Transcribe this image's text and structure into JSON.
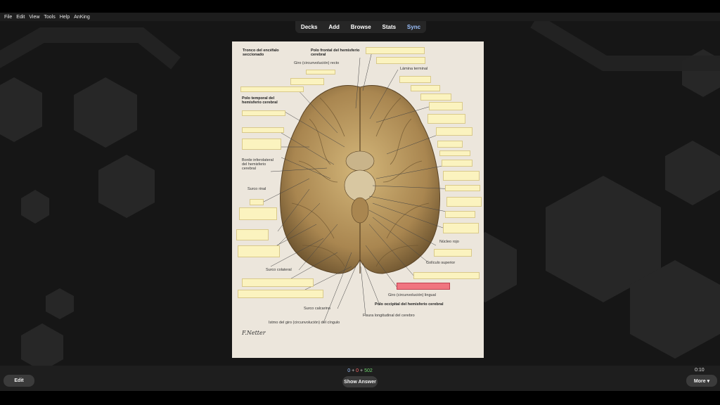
{
  "menu": [
    "File",
    "Edit",
    "View",
    "Tools",
    "Help",
    "AnKing"
  ],
  "tabs": [
    "Decks",
    "Add",
    "Browse",
    "Stats",
    "Sync"
  ],
  "card": {
    "labels": {
      "tronco": "Tronco del encéfalo seccionado",
      "polo_frontal": "Polo frontal del hemisferio cerebral",
      "giro_recto": "Giro (circunvolución) recto",
      "lamina_terminal": "Lámina terminal",
      "polo_temporal": "Polo temporal del hemisferio cerebral",
      "borde": "Borde inferolateral del hemisferio cerebral",
      "surco_rinal": "Surco rinal",
      "nucleo_rojo": "Núcleo rojo",
      "coliculo": "Colículo superior",
      "surco_colateral": "Surco colateral",
      "giro_lingual": "Giro (circunvolución) lingual",
      "polo_occipital": "Polo occipital del hemisferio cerebral",
      "surco_calcarino": "Surco calcarino",
      "fisura": "Fisura longitudinal del cerebro",
      "istmo": "Istmo del giro (circunvolución) del cíngulo"
    },
    "signature": "F.Netter"
  },
  "counts": {
    "new": "0",
    "learn": "0",
    "review": "502",
    "sep": "+"
  },
  "timer": "0:10",
  "buttons": {
    "edit": "Edit",
    "show_answer": "Show Answer",
    "more": "More ▾"
  }
}
